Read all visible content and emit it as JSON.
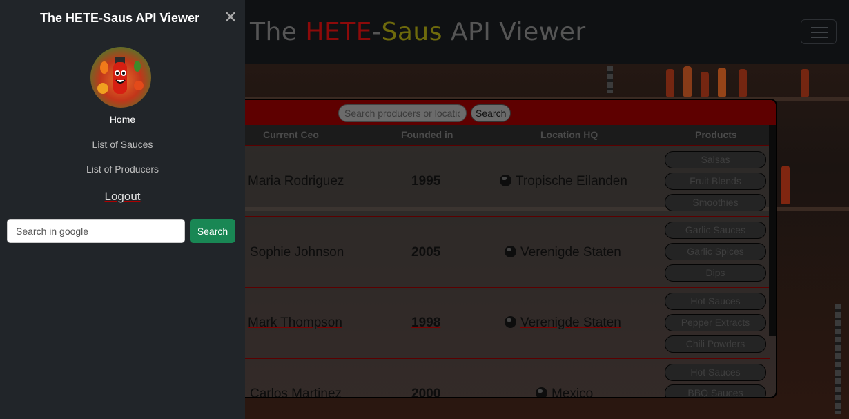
{
  "navbar": {
    "brand_prefix": "The ",
    "brand_red": "HETE",
    "brand_dash": "-",
    "brand_yellow": "Saus",
    "brand_suffix": " API Viewer"
  },
  "sidebar": {
    "title": "The HETE-Saus API Viewer",
    "home": "Home",
    "list_sauces": "List of Sauces",
    "list_producers": "List of Producers",
    "logout": "Logout",
    "google_placeholder": "Search in google",
    "google_button": "Search"
  },
  "table": {
    "search_placeholder": "Search producers or location",
    "search_button": "Search",
    "headers": [
      "Current Ceo",
      "Founded in",
      "Location HQ",
      "Products"
    ],
    "rows": [
      {
        "ceo": "Maria Rodriguez",
        "founded": "1995",
        "location": "Tropische Eilanden",
        "products": [
          "Salsas",
          "Fruit Blends",
          "Smoothies"
        ]
      },
      {
        "ceo": "Sophie Johnson",
        "founded": "2005",
        "location": "Verenigde Staten",
        "products": [
          "Garlic Sauces",
          "Garlic Spices",
          "Dips"
        ]
      },
      {
        "ceo": "Mark Thompson",
        "founded": "1998",
        "location": "Verenigde Staten",
        "products": [
          "Hot Sauces",
          "Pepper Extracts",
          "Chili Powders"
        ]
      },
      {
        "ceo": "Carlos Martinez",
        "founded": "2000",
        "location": "Mexico",
        "products": [
          "Hot Sauces",
          "BBQ Sauces"
        ]
      }
    ]
  },
  "colors": {
    "accent_red": "#8c0a0a",
    "accent_yellow": "#6e6a0c",
    "search_green": "#198754",
    "sidebar_bg": "#212529"
  }
}
